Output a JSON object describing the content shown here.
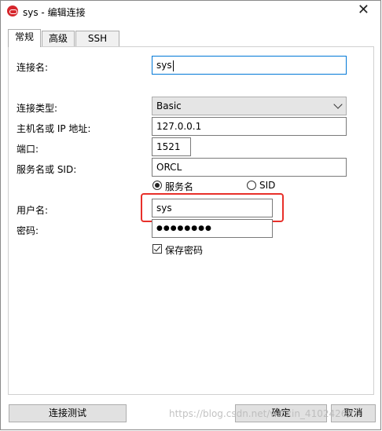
{
  "window": {
    "title": "sys - 编辑连接"
  },
  "tabs": [
    {
      "label": "常规",
      "active": true
    },
    {
      "label": "高级"
    },
    {
      "label": "SSH"
    }
  ],
  "form": {
    "connection_name_label": "连接名:",
    "connection_name_value": "sys",
    "connection_type_label": "连接类型:",
    "connection_type_value": "Basic",
    "host_label": "主机名或 IP 地址:",
    "host_value": "127.0.0.1",
    "port_label": "端口:",
    "port_value": "1521",
    "service_label": "服务名或 SID:",
    "service_value": "ORCL",
    "radio_service_name": "服务名",
    "radio_sid": "SID",
    "username_label": "用户名:",
    "username_value": "sys",
    "password_label": "密码:",
    "password_value": "●●●●●●●●",
    "save_password_label": "保存密码",
    "save_password_checked": true
  },
  "buttons": {
    "test": "连接测试",
    "ok": "确定",
    "cancel": "取消"
  },
  "watermark": "https://blog.csdn.net/weixin_41024263",
  "colors": {
    "highlight": "#e8302a",
    "focus": "#0078d7",
    "oracle_icon": "#d6262c"
  }
}
